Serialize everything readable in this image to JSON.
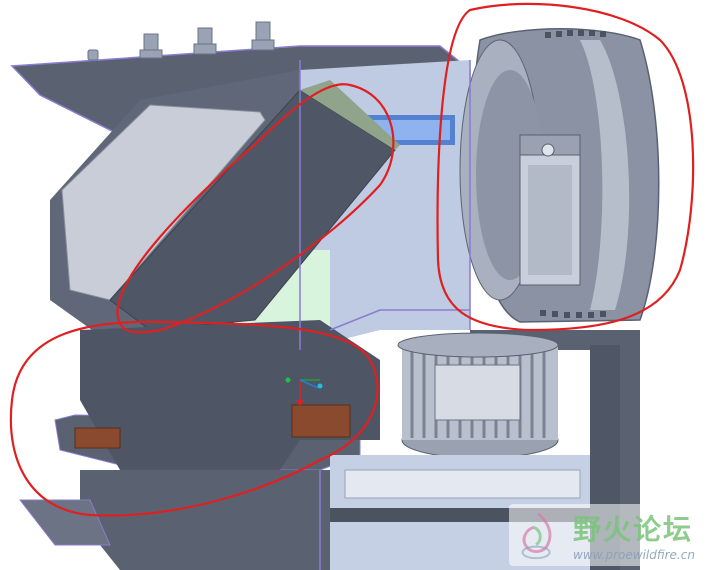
{
  "viewport": {
    "title": "",
    "background": "#ffffff",
    "model_colors": {
      "body_dark": "#565e6e",
      "body_mid": "#6b7384",
      "body_light": "#a7b0c2",
      "panel_blue": "#b9c7df",
      "panel_green": "#d8f4dc",
      "accent_blue": "#3a6fd0",
      "edge_purple": "#8a7ccf",
      "copper": "#8a4a2e",
      "highlight_red": "#e02020"
    },
    "annotations": [
      {
        "name": "upper-left-board-circle",
        "color": "#e02020"
      },
      {
        "name": "blower-housing-circle",
        "color": "#e02020"
      },
      {
        "name": "lower-left-board-circle",
        "color": "#e02020"
      }
    ],
    "triad_icon": "coordinate-axis-icon"
  },
  "watermark": {
    "title": "野火论坛",
    "url": "www.proewildfire.cn",
    "logo_icon": "wildfire-logo-icon"
  }
}
